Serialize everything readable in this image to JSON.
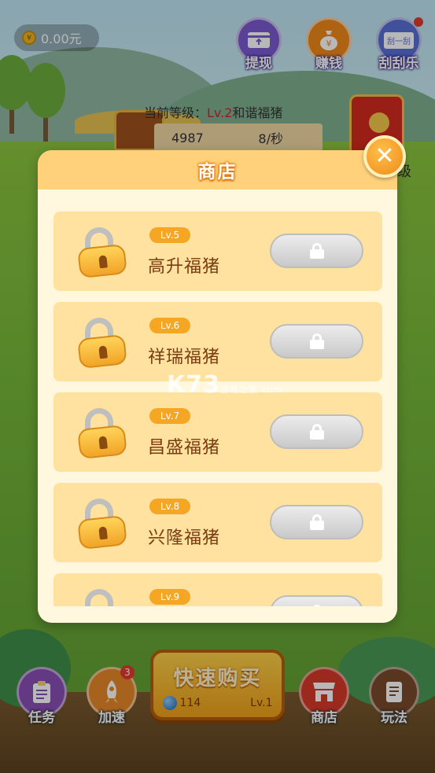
{
  "hud": {
    "balance": "0.00元",
    "top_buttons": [
      {
        "label": "提现",
        "icon": "withdraw-card-icon",
        "color": "#7a5bd1"
      },
      {
        "label": "赚钱",
        "icon": "money-bag-icon",
        "color": "#f08a1a"
      },
      {
        "label": "刮刮乐",
        "icon": "scratch-card-icon",
        "color": "#5a6fd6",
        "card_text": "刮一刮"
      }
    ]
  },
  "status": {
    "level_prefix": "当前等级：",
    "level": "Lv.2",
    "level_name": "和谐福猪",
    "coins": "4987",
    "rate": "8/秒",
    "side_text": "级"
  },
  "shop": {
    "title": "商店",
    "items": [
      {
        "level": "Lv.5",
        "name": "高升福猪",
        "locked": true
      },
      {
        "level": "Lv.6",
        "name": "祥瑞福猪",
        "locked": true
      },
      {
        "level": "Lv.7",
        "name": "昌盛福猪",
        "locked": true
      },
      {
        "level": "Lv.8",
        "name": "兴隆福猪",
        "locked": true
      },
      {
        "level": "Lv.9",
        "name": "",
        "locked": true
      }
    ]
  },
  "watermark": {
    "main": "K73",
    "sub": "游戏之家",
    "domain": ".com"
  },
  "bottom": {
    "task": {
      "label": "任务",
      "icon": "task-clipboard-icon",
      "color": "#8a4fb8"
    },
    "speed": {
      "label": "加速",
      "icon": "rocket-icon",
      "color": "#e88a2a",
      "badge": "3"
    },
    "quick_buy": {
      "title": "快速购买",
      "cost": "114",
      "level": "Lv.1"
    },
    "shop": {
      "label": "商店",
      "icon": "shop-stall-icon",
      "color": "#d83a2a"
    },
    "help": {
      "label": "玩法",
      "icon": "rulebook-icon",
      "color": "#7a4a2a"
    }
  }
}
